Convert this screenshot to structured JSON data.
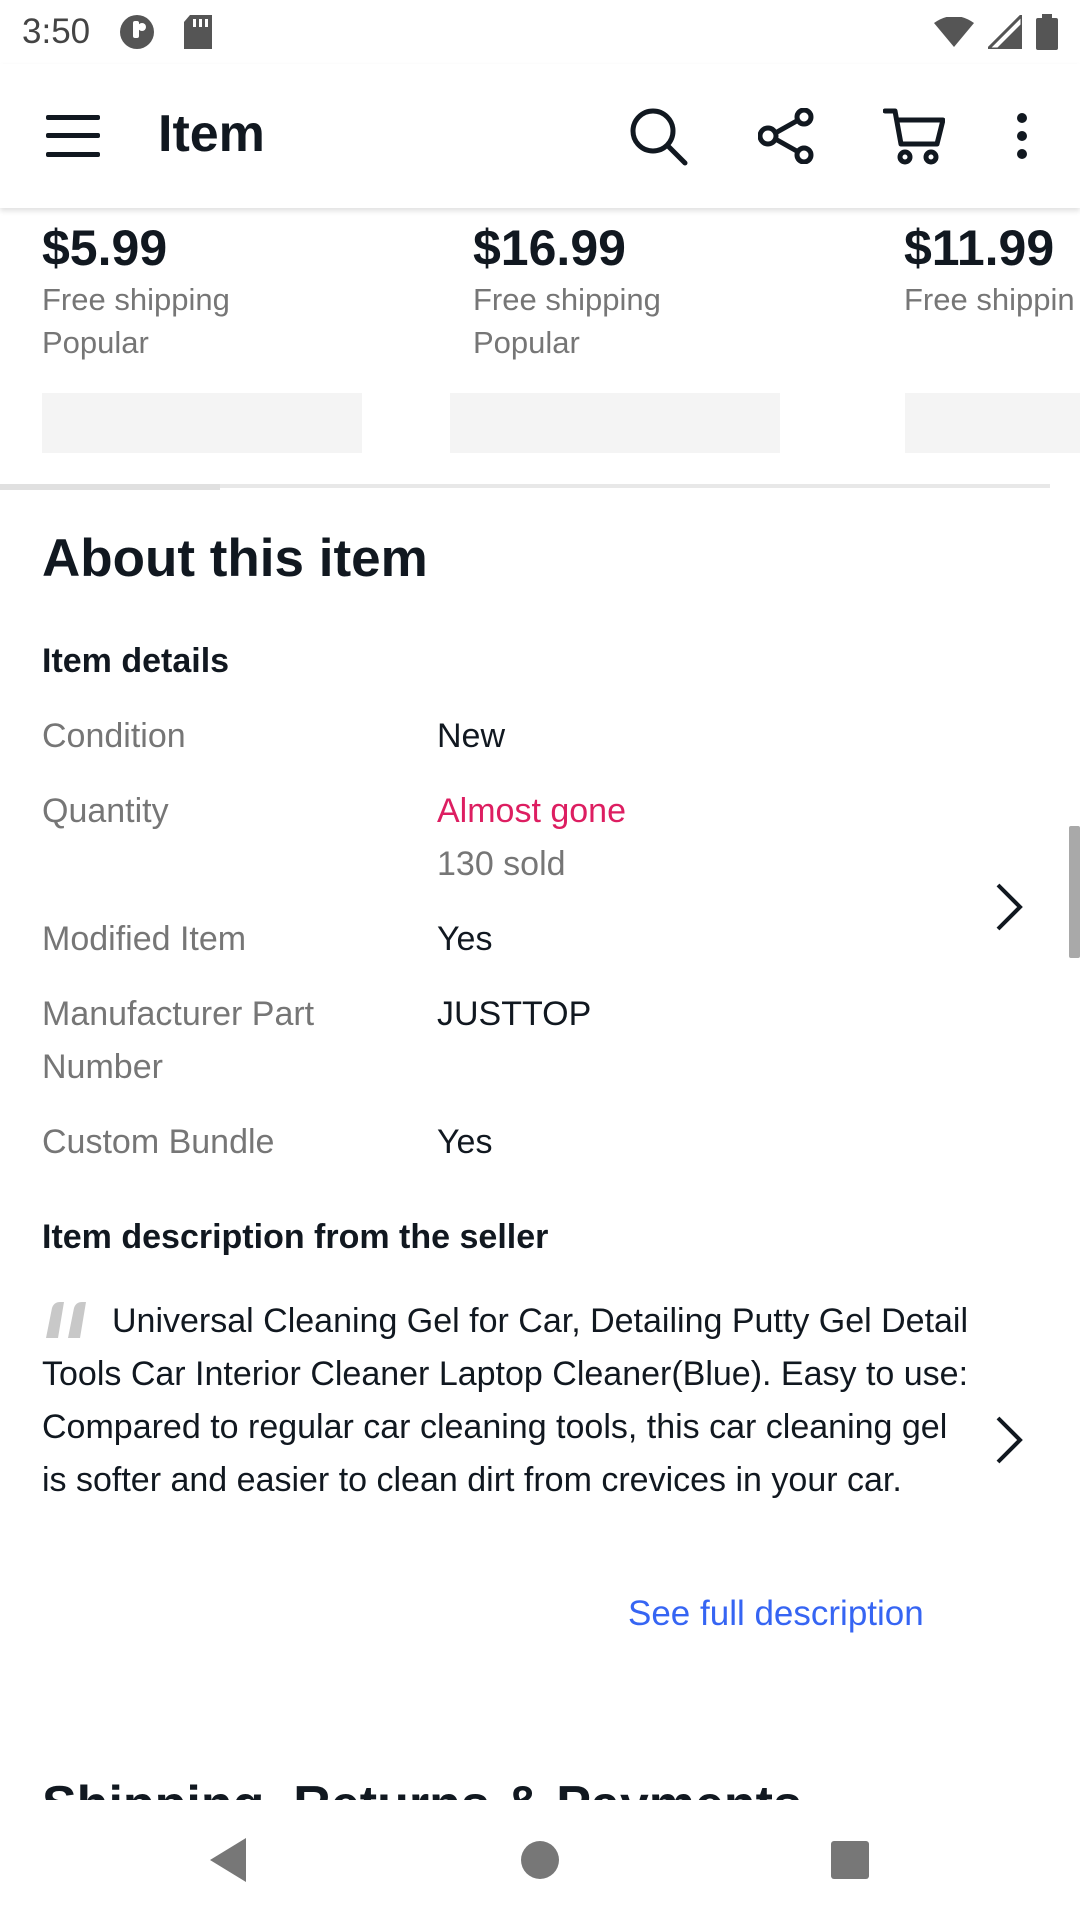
{
  "status_bar": {
    "time": "3:50"
  },
  "app_bar": {
    "title": "Item",
    "icons": [
      "menu-icon",
      "search-icon",
      "share-icon",
      "cart-icon",
      "more-icon"
    ]
  },
  "carousel": {
    "items": [
      {
        "price": "$5.99",
        "shipping": "Free shipping",
        "tag": "Popular"
      },
      {
        "price": "$16.99",
        "shipping": "Free shipping",
        "tag": "Popular"
      },
      {
        "price": "$11.99",
        "shipping": "Free shippin",
        "tag": ""
      }
    ]
  },
  "about": {
    "title": "About this item",
    "details_heading": "Item details",
    "specs": [
      {
        "label": "Condition",
        "value": "New"
      },
      {
        "label": "Quantity",
        "value": "Almost gone",
        "sub": "130 sold"
      },
      {
        "label": "Modified Item",
        "value": "Yes"
      },
      {
        "label": "Manufacturer Part Number",
        "value": "JUSTTOP"
      },
      {
        "label": "Custom Bundle",
        "value": "Yes"
      }
    ],
    "description_heading": "Item description from the seller",
    "description": "Universal Cleaning Gel for Car, Detailing Putty Gel Detail Tools Car Interior Cleaner Laptop Cleaner(Blue). Easy to use: Compared to regular car cleaning tools, this car cleaning gel is softer and easier to clean dirt from crevices in your car.",
    "see_full": "See full description",
    "next_section": "Shipping, Returns & Payments"
  },
  "colors": {
    "text": "#111820",
    "muted": "#767676",
    "alert": "#dd1e61",
    "link": "#3665f3"
  }
}
